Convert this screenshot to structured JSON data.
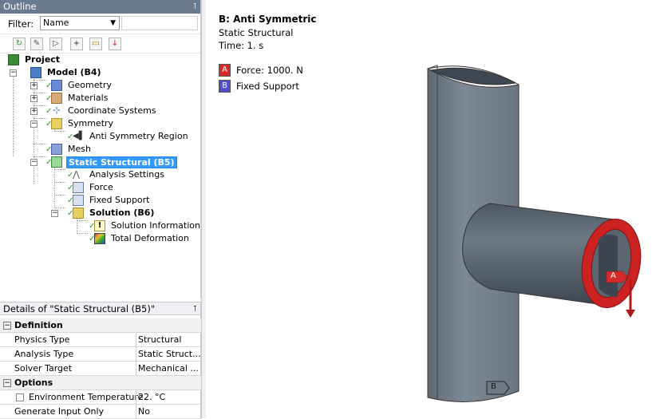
{
  "outline": {
    "title": "Outline",
    "pin": "⊺",
    "filter_label": "Filter:",
    "filter_value": "Name",
    "tree": {
      "project": "Project",
      "model": "Model (B4)",
      "geometry": "Geometry",
      "materials": "Materials",
      "coordinate_systems": "Coordinate Systems",
      "symmetry": "Symmetry",
      "anti_symmetry": "Anti Symmetry Region",
      "mesh": "Mesh",
      "static_structural": "Static Structural (B5)",
      "analysis_settings": "Analysis Settings",
      "force": "Force",
      "fixed_support": "Fixed Support",
      "solution": "Solution (B6)",
      "solution_information": "Solution Information",
      "total_deformation": "Total Deformation"
    }
  },
  "details": {
    "title": "Details of \"Static Structural (B5)\"",
    "pin": "⊺",
    "sections": {
      "definition": "Definition",
      "options": "Options"
    },
    "rows": {
      "physics_type": {
        "name": "Physics Type",
        "value": "Structural"
      },
      "analysis_type": {
        "name": "Analysis Type",
        "value": "Static Struct..."
      },
      "solver_target": {
        "name": "Solver Target",
        "value": "Mechanical ..."
      },
      "env_temp": {
        "name": "Environment Temperature",
        "value": "22. °C"
      },
      "gen_input": {
        "name": "Generate Input Only",
        "value": "No"
      }
    }
  },
  "graphics": {
    "analysis_title": "B: Anti Symmetric",
    "analysis_subtitle": "Static Structural",
    "time": "Time: 1. s",
    "legend": [
      {
        "badge": "A",
        "text": "Force: 1000. N",
        "color": "#d42a2a"
      },
      {
        "badge": "B",
        "text": "Fixed Support",
        "color": "#5050c8"
      }
    ],
    "label_a": "A",
    "label_b": "B"
  },
  "colors": {
    "title_bar": "#6b7b8f",
    "selection": "#3399ff",
    "pipe": "#6f7a85",
    "force": "#cc2222"
  }
}
